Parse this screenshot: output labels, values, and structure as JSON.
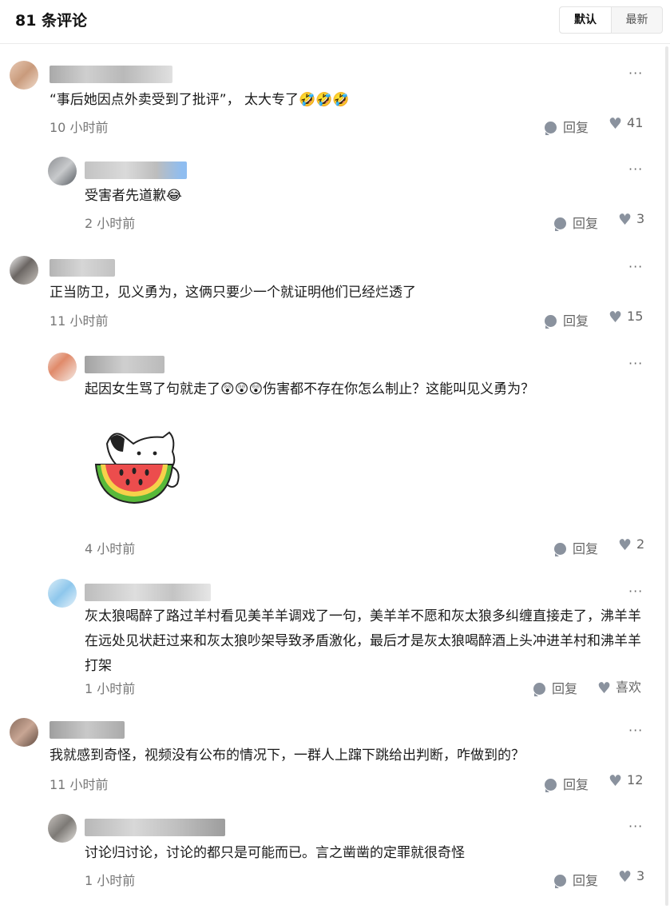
{
  "header": {
    "title": "81 条评论",
    "sort_default": "默认",
    "sort_latest": "最新"
  },
  "labels": {
    "reply": "回复",
    "more": "···"
  },
  "comments": [
    {
      "text": "“事后她因点外卖受到了批评”， 太大专了",
      "emoji": "🤣🤣🤣",
      "time": "10 小时前",
      "likes": "41"
    },
    {
      "text": "受害者先道歉",
      "emoji": "😂",
      "time": "2 小时前",
      "likes": "3"
    },
    {
      "text": "正当防卫，见义勇为，这俩只要少一个就证明他们已经烂透了",
      "time": "11 小时前",
      "likes": "15"
    },
    {
      "text_before": "起因女生骂了句就走了",
      "emoji": "😲😲😲",
      "text_after": "伤害都不存在你怎么制止？这能叫见义勇为？",
      "time": "4 小时前",
      "likes": "2"
    },
    {
      "text": "灰太狼喝醉了路过羊村看见美羊羊调戏了一句，美羊羊不愿和灰太狼多纠缠直接走了，沸羊羊在远处见状赶过来和灰太狼吵架导致矛盾激化，最后才是灰太狼喝醉酒上头冲进羊村和沸羊羊打架",
      "time": "1 小时前",
      "likes": "喜欢"
    },
    {
      "text": "我就感到奇怪，视频没有公布的情况下，一群人上蹿下跳给出判断，咋做到的？",
      "time": "11 小时前",
      "likes": "12"
    },
    {
      "text": "讨论归讨论，讨论的都只是可能而已。言之凿凿的定罪就很奇怪",
      "time": "1 小时前",
      "likes": "3"
    }
  ],
  "colors": {
    "icon_gray": "#8a929e",
    "text_primary": "#1a1a1a",
    "meta": "#777777"
  }
}
